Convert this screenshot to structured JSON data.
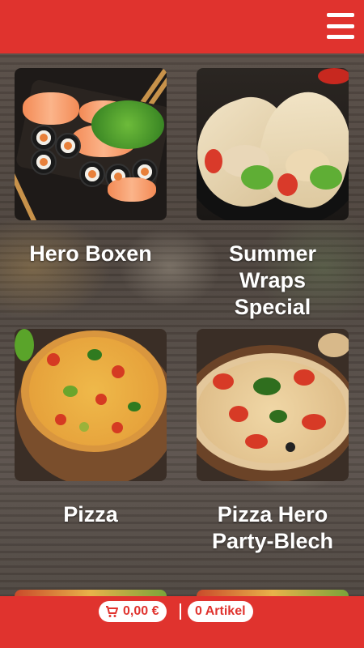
{
  "header": {
    "menu_icon": "hamburger-menu-icon",
    "background": "#e0332e"
  },
  "categories": [
    {
      "label": "Hero Boxen",
      "image": "sushi-platter"
    },
    {
      "label": "Summer\nWraps\nSpecial",
      "image": "chicken-wraps"
    },
    {
      "label": "Pizza",
      "image": "pizza"
    },
    {
      "label": "Pizza Hero\nParty-Blech",
      "image": "party-pizza"
    }
  ],
  "footer": {
    "cart_icon": "shopping-cart-icon",
    "total": "0,00 €",
    "items": "0 Artikel",
    "background": "#e0332e"
  }
}
